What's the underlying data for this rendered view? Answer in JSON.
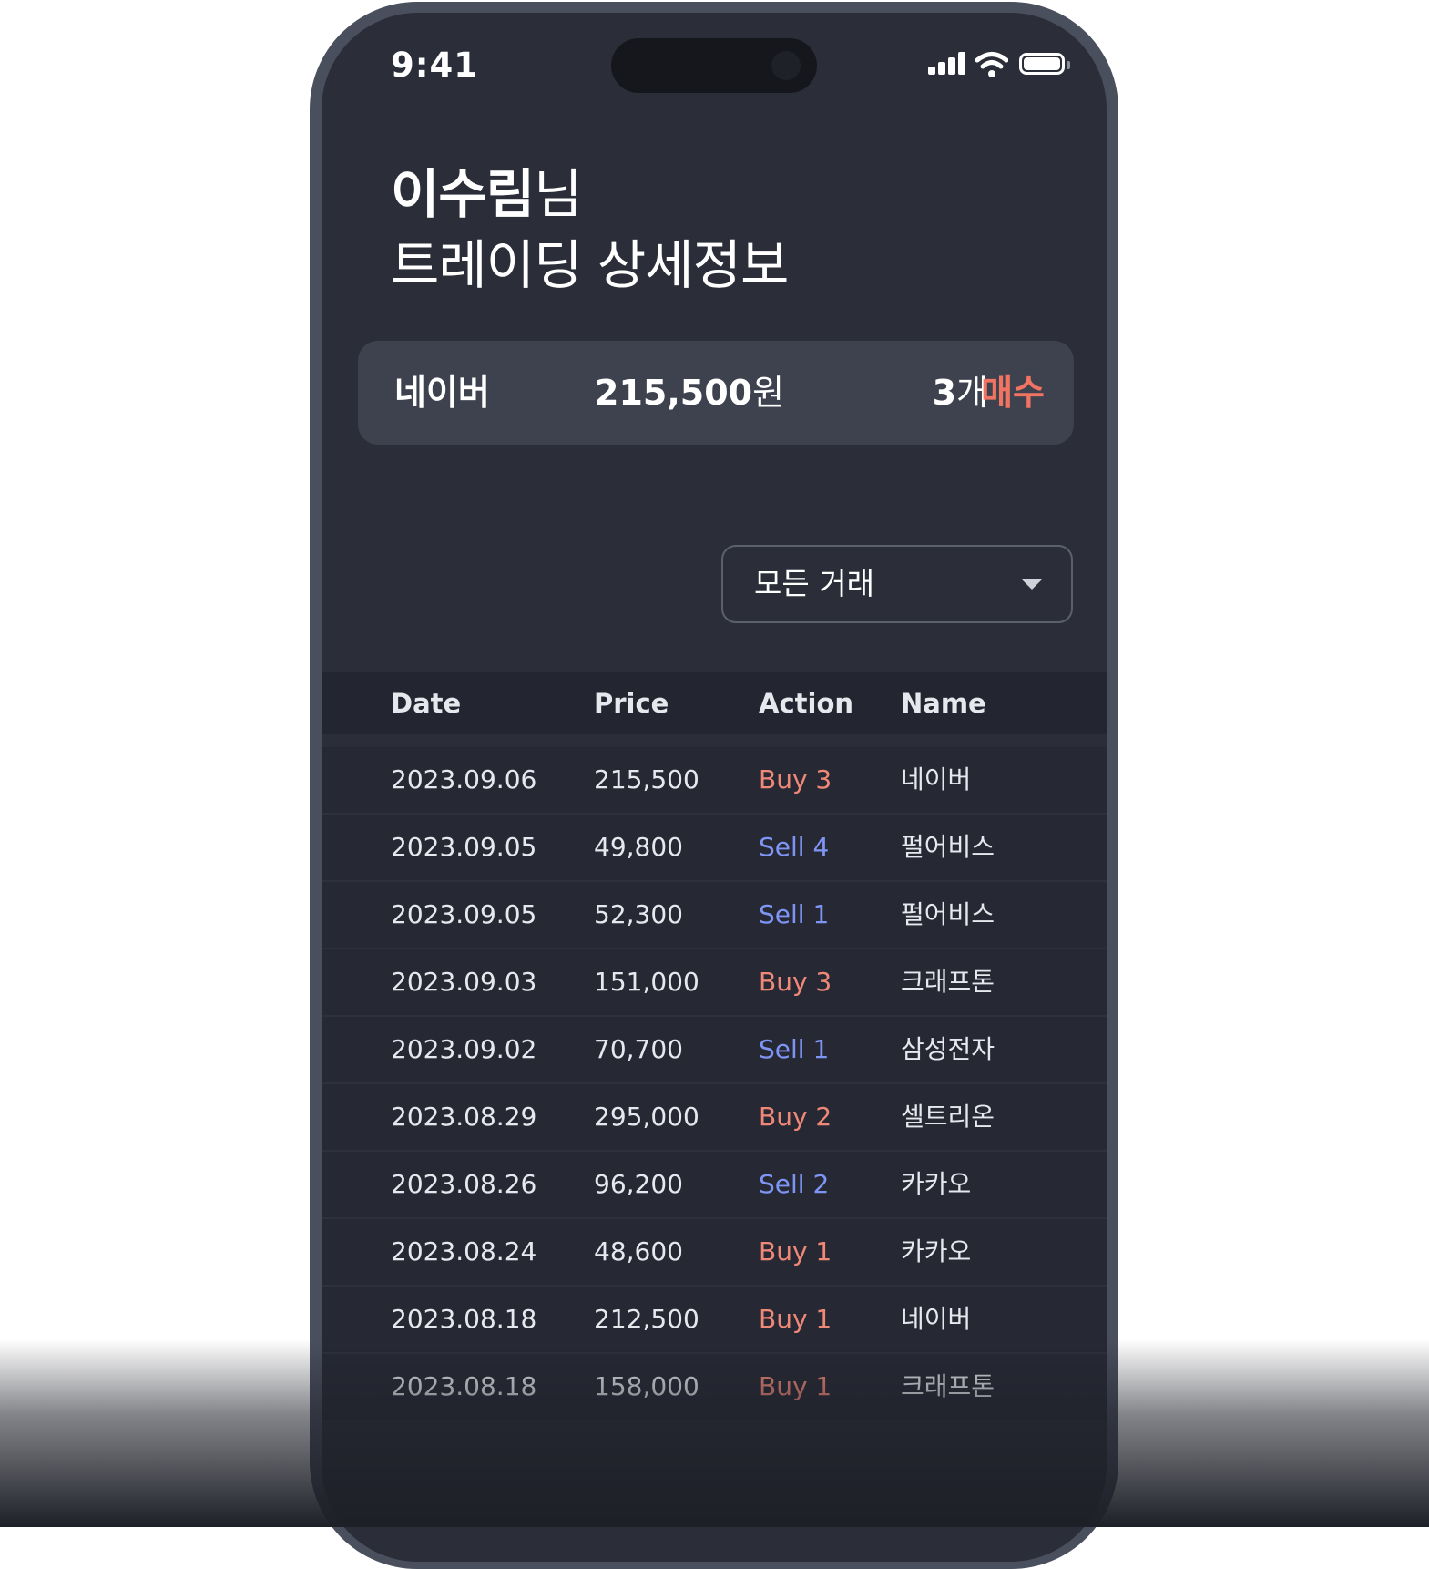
{
  "status_bar": {
    "time": "9:41"
  },
  "header": {
    "user_name": "이수림",
    "honorific": "님",
    "subtitle": "트레이딩 상세정보"
  },
  "summary": {
    "stock_name": "네이버",
    "price": "215,500",
    "price_unit": "원",
    "quantity": "3",
    "quantity_unit": "개",
    "action": "매수"
  },
  "filter": {
    "selected": "모든 거래"
  },
  "table": {
    "headers": {
      "date": "Date",
      "price": "Price",
      "action": "Action",
      "name": "Name"
    },
    "rows": [
      {
        "date": "2023.09.06",
        "price": "215,500",
        "action": "Buy 3",
        "type": "buy",
        "name": "네이버"
      },
      {
        "date": "2023.09.05",
        "price": "49,800",
        "action": "Sell 4",
        "type": "sell",
        "name": "펄어비스"
      },
      {
        "date": "2023.09.05",
        "price": "52,300",
        "action": "Sell 1",
        "type": "sell",
        "name": "펄어비스"
      },
      {
        "date": "2023.09.03",
        "price": "151,000",
        "action": "Buy 3",
        "type": "buy",
        "name": "크래프톤"
      },
      {
        "date": "2023.09.02",
        "price": "70,700",
        "action": "Sell 1",
        "type": "sell",
        "name": "삼성전자"
      },
      {
        "date": "2023.08.29",
        "price": "295,000",
        "action": "Buy 2",
        "type": "buy",
        "name": "셀트리온"
      },
      {
        "date": "2023.08.26",
        "price": "96,200",
        "action": "Sell 2",
        "type": "sell",
        "name": "카카오"
      },
      {
        "date": "2023.08.24",
        "price": "48,600",
        "action": "Buy 1",
        "type": "buy",
        "name": "카카오"
      },
      {
        "date": "2023.08.18",
        "price": "212,500",
        "action": "Buy 1",
        "type": "buy",
        "name": "네이버"
      },
      {
        "date": "2023.08.18",
        "price": "158,000",
        "action": "Buy 1",
        "type": "buy",
        "name": "크래프톤"
      }
    ]
  },
  "colors": {
    "buy": "#f08878",
    "sell": "#7f95f5",
    "accent_buy": "#f07461",
    "screen_bg": "#2b2e39"
  }
}
